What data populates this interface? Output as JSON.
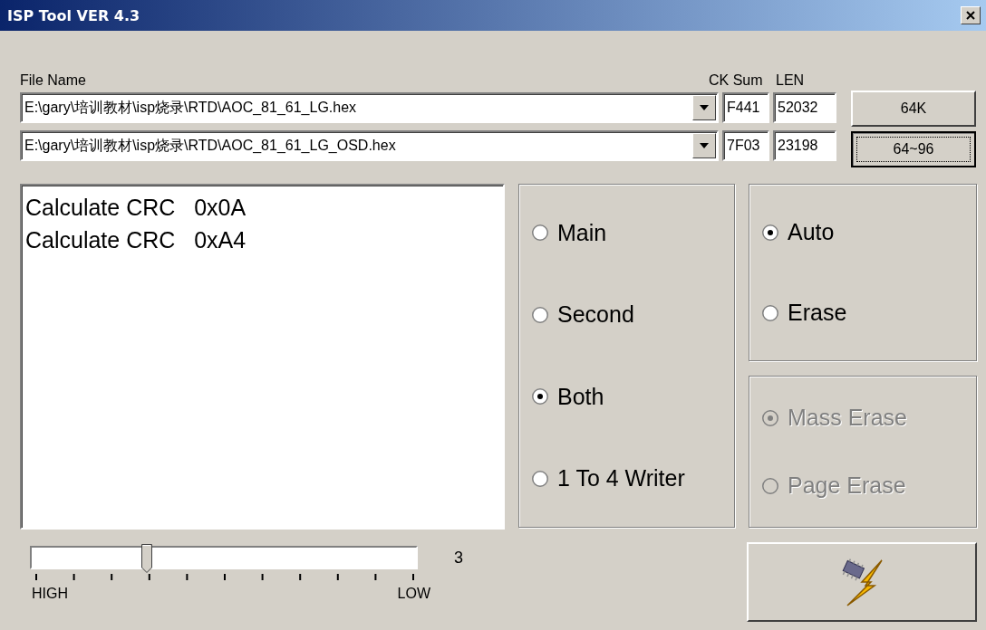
{
  "window": {
    "title": "ISP Tool VER 4.3"
  },
  "files": {
    "label": "File Name",
    "checksum_label": "CK Sum",
    "length_label": "LEN",
    "rows": [
      {
        "path": "E:\\gary\\培训教材\\isp烧录\\RTD\\AOC_81_61_LG.hex",
        "checksum": "F441",
        "length": "52032"
      },
      {
        "path": "E:\\gary\\培训教材\\isp烧录\\RTD\\AOC_81_61_LG_OSD.hex",
        "checksum": "7F03",
        "length": "23198"
      }
    ]
  },
  "size_buttons": [
    {
      "label": "64K",
      "selected": false
    },
    {
      "label": "64~96",
      "selected": true
    }
  ],
  "log": [
    "Calculate CRC   0x0A",
    "Calculate CRC   0xA4"
  ],
  "target": [
    {
      "label": "Main",
      "selected": false
    },
    {
      "label": "Second",
      "selected": false
    },
    {
      "label": "Both",
      "selected": true
    },
    {
      "label": "1 To 4 Writer",
      "selected": false
    }
  ],
  "mode": [
    {
      "label": "Auto",
      "selected": true
    },
    {
      "label": "Erase",
      "selected": false
    }
  ],
  "erase_type": {
    "disabled": true,
    "options": [
      {
        "label": "Mass Erase",
        "selected": true
      },
      {
        "label": "Page Erase",
        "selected": false
      }
    ]
  },
  "speed": {
    "level": 0.3,
    "value": "3",
    "min_label": "HIGH",
    "max_label": "LOW"
  }
}
